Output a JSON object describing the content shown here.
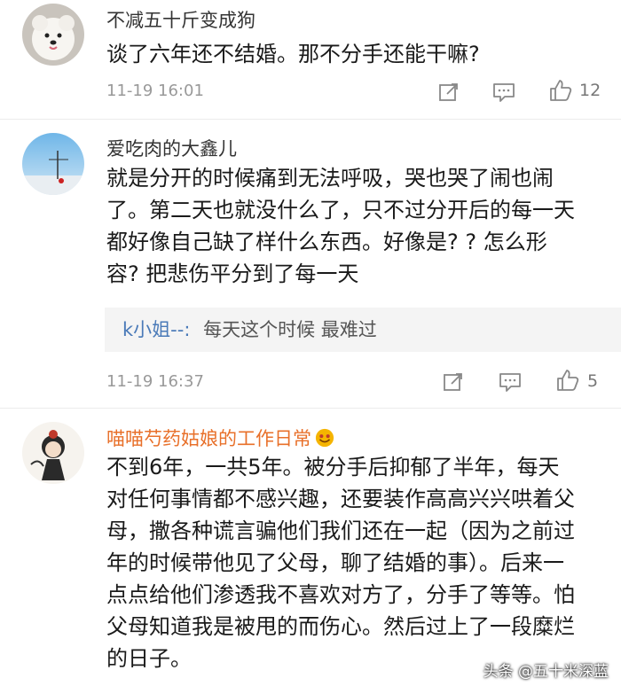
{
  "comments": [
    {
      "username": "不减五十斤变成狗",
      "text": "谈了六年还不结婚。那不分手还能干嘛?",
      "time": "11-19 16:01",
      "likes": "12",
      "avatar_icon": "white-dog-avatar"
    },
    {
      "username": "爱吃肉的大鑫儿",
      "text": "就是分开的时候痛到无法呼吸，哭也哭了闹也闹\n了。第二天也就没什么了，只不过分开后的每一天\n都好像自己缺了样什么东西。好像是? ? 怎么形\n容? 把悲伤平分到了每一天",
      "reply": {
        "user": "k小姐--:",
        "text": "每天这个时候 最难过"
      },
      "time": "11-19 16:37",
      "likes": "5",
      "avatar_icon": "sky-avatar"
    },
    {
      "username": "喵喵芍药姑娘的工作日常",
      "username_color": "#e8702a",
      "badge_icon": "smiling-face-emoji",
      "text": "不到6年，一共5年。被分手后抑郁了半年，每天\n对任何事情都不感兴趣，还要装作高高兴兴哄着父\n母，撒各种谎言骗他们我们还在一起（因为之前过\n年的时候带他见了父母，聊了结婚的事）。后来一\n点点给他们渗透我不喜欢对方了，分手了等等。怕\n父母知道我是被甩的而伤心。然后过上了一段糜烂\n的日子。",
      "avatar_icon": "cartoon-girl-avatar"
    }
  ],
  "icons": {
    "share": "share-icon",
    "comment": "comment-icon",
    "like": "thumbs-up-icon"
  },
  "watermark": "头条 @五十米深蓝"
}
